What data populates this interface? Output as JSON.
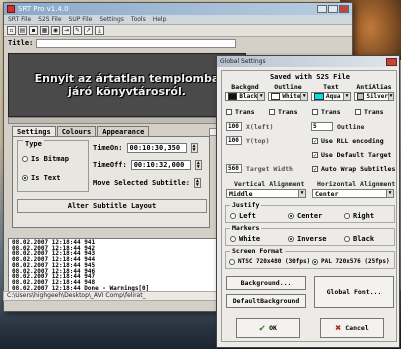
{
  "window": {
    "title": "SRT Pro v1.4.0",
    "menu": [
      "SRT File",
      "S2S File",
      "SUP File",
      "Settings",
      "Tools",
      "Help"
    ]
  },
  "title_field": {
    "label": "Title:",
    "value": ""
  },
  "preview": {
    "subtitle_text": "Ennyit az ártatlan templomba járó könyvtárosról."
  },
  "tabs": [
    {
      "label": "Settings",
      "active": true
    },
    {
      "label": "Colours",
      "active": false
    },
    {
      "label": "Appearance",
      "active": false
    }
  ],
  "settings": {
    "type_label": "Type",
    "radio_bitmap": "Is Bitmap",
    "radio_text": "Is Text",
    "selected_type": "Is Text",
    "time_on_label": "TimeOn:",
    "time_on_value": "00:10:30,350",
    "time_off_label": "TimeOff:",
    "time_off_value": "00:10:32,000",
    "move_label": "Move Selected Subtitle:",
    "alter_button": "Alter Subtitle Layout"
  },
  "log": [
    "08.02.2007 12:18:44 941",
    "08.02.2007 12:18:44 942",
    "08.02.2007 12:18:44 943",
    "08.02.2007 12:18:44 944",
    "08.02.2007 12:18:44 945",
    "08.02.2007 12:18:44 946",
    "08.02.2007 12:18:44 947",
    "08.02.2007 12:18:44 948",
    "08.02.2007 12:18:44 Done - Warnings[0]"
  ],
  "statusbar": "C:\\Users\\highgeeh\\Desktop\\_AVI Comp\\felirat_",
  "global": {
    "title": "Global Settings",
    "heading": "Saved with S2S File",
    "columns": [
      {
        "label": "Backgnd",
        "value": "Black",
        "color": "#111111"
      },
      {
        "label": "Outline",
        "value": "White",
        "color": "#ffffff"
      },
      {
        "label": "Text",
        "value": "Aqua",
        "color": "#00e0e0"
      },
      {
        "label": "AntiAlias",
        "value": "Silver",
        "color": "#c0c0c0"
      }
    ],
    "trans_label": "Trans",
    "x_value": "100",
    "x_label": "X(left)",
    "y_value": "100",
    "y_label": "Y(top)",
    "outline_value": "5",
    "outline_label": "Outline",
    "use_rll": "Use RLL encoding",
    "use_default_target": "Use Default Target",
    "auto_wrap": "Auto Wrap Subtitles",
    "target_width_value": "560",
    "target_width_label": "Target Width",
    "valign_label": "Vertical Alignment",
    "valign_value": "Middle",
    "halign_label": "Horizontal Alignment",
    "halign_value": "Center",
    "justify_label": "Justify",
    "justify_options": [
      "Left",
      "Center",
      "Right"
    ],
    "justify_selected": "Center",
    "markers_label": "Markers",
    "markers_options": [
      "White",
      "Inverse",
      "Black"
    ],
    "markers_selected": "Inverse",
    "screen_label": "Screen Format",
    "screen_options": [
      "NTSC 720x480 (30fps)",
      "PAL 720x576 (25fps)"
    ],
    "screen_selected": "PAL 720x576 (25fps)",
    "background_btn": "Background...",
    "default_bg_btn": "DefaultBackground",
    "global_font_btn": "Global Font...",
    "ok_btn": "OK",
    "cancel_btn": "Cancel"
  }
}
